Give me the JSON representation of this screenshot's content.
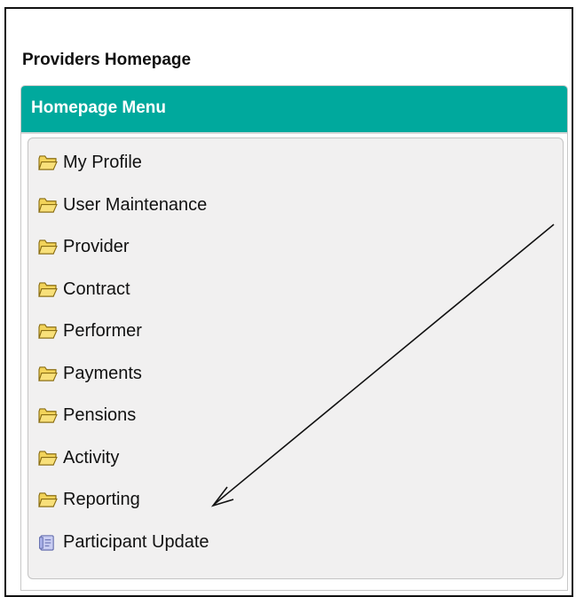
{
  "page": {
    "title": "Providers Homepage"
  },
  "menu": {
    "header": "Homepage Menu",
    "items": [
      {
        "label": "My Profile",
        "icon": "folder-icon"
      },
      {
        "label": "User Maintenance",
        "icon": "folder-icon"
      },
      {
        "label": "Provider",
        "icon": "folder-icon"
      },
      {
        "label": "Contract",
        "icon": "folder-icon"
      },
      {
        "label": "Performer",
        "icon": "folder-icon"
      },
      {
        "label": "Payments",
        "icon": "folder-icon"
      },
      {
        "label": "Pensions",
        "icon": "folder-icon"
      },
      {
        "label": "Activity",
        "icon": "folder-icon"
      },
      {
        "label": "Reporting",
        "icon": "folder-icon"
      },
      {
        "label": "Participant Update",
        "icon": "document-icon"
      }
    ]
  },
  "colors": {
    "header_bg": "#00a99d",
    "header_text": "#ffffff",
    "menu_body_bg": "#f1f0f0",
    "folder_fill": "#f2d35a",
    "folder_stroke": "#8a6d12",
    "document_fill": "#c9cdf2"
  },
  "annotation": {
    "type": "arrow",
    "points_to": "Reporting"
  }
}
